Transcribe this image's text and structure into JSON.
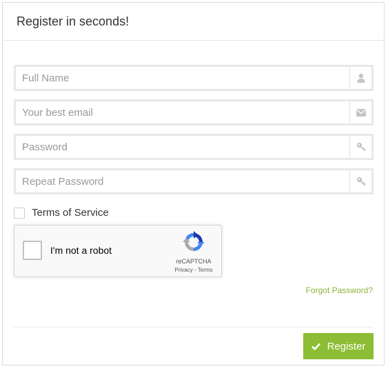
{
  "header": {
    "title": "Register in seconds!"
  },
  "form": {
    "fields": [
      {
        "placeholder": "Full Name",
        "value": "",
        "icon": "user-icon"
      },
      {
        "placeholder": "Your best email",
        "value": "",
        "icon": "envelope-icon"
      },
      {
        "placeholder": "Password",
        "value": "",
        "icon": "key-icon"
      },
      {
        "placeholder": "Repeat Password",
        "value": "",
        "icon": "key-icon"
      }
    ],
    "terms_label": "Terms of Service",
    "terms_checked": false
  },
  "captcha": {
    "label": "I'm not a robot",
    "brand": "reCAPTCHA",
    "links": "Privacy - Terms",
    "checked": false
  },
  "links": {
    "forgot_password": "Forgot Password?"
  },
  "actions": {
    "register_label": "Register"
  },
  "colors": {
    "accent": "#8cbd34",
    "link": "#8bb33a",
    "border": "#e8e8e8"
  }
}
